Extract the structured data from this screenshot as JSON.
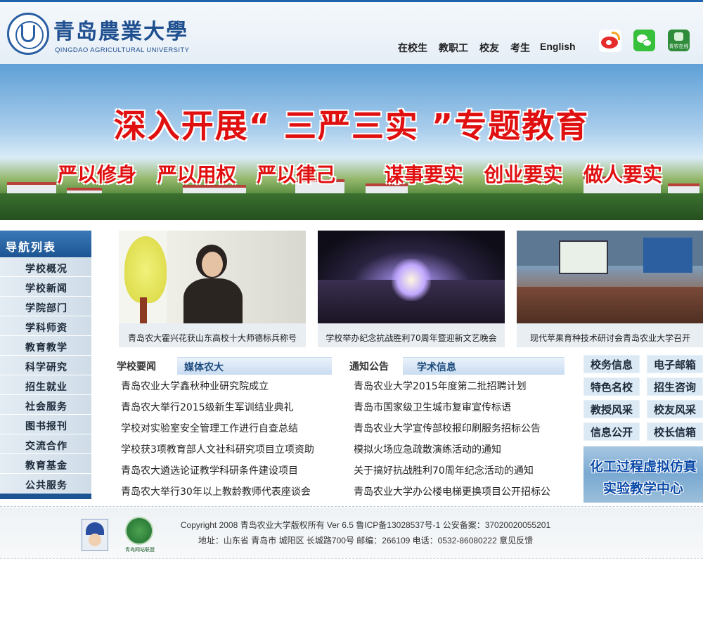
{
  "header": {
    "logo_cn": "青岛農業大學",
    "logo_en": "QINGDAO AGRICULTURAL UNIVERSITY",
    "nav": [
      "在校生",
      "教职工",
      "校友",
      "考生",
      "English"
    ],
    "social_icons": [
      "weibo-icon",
      "wechat-icon",
      "app-icon"
    ],
    "app_icon_label": "青农在线"
  },
  "banner": {
    "title": "深入开展“ 三严三实 ”专题教育",
    "slogans": [
      "严以修身",
      "严以用权",
      "严以律己",
      "谋事要实",
      "创业要实",
      "做人要实"
    ]
  },
  "sidebar": {
    "heading": "导航列表",
    "items": [
      "学校概况",
      "学校新闻",
      "学院部门",
      "学科师资",
      "教育教学",
      "科学研究",
      "招生就业",
      "社会服务",
      "图书报刊",
      "交流合作",
      "教育基金",
      "公共服务"
    ]
  },
  "photos": [
    {
      "caption": "青岛农大霍兴花获山东高校十大师德标兵称号"
    },
    {
      "caption": "学校举办纪念抗战胜利70周年暨迎新文艺晚会"
    },
    {
      "caption": "现代苹果育种技术研讨会青岛农业大学召开"
    }
  ],
  "news": {
    "tabs": [
      "学校要闻",
      "媒体农大"
    ],
    "items": [
      "青岛农业大学鑫秋种业研究院成立",
      "青岛农大举行2015级新生军训结业典礼",
      "学校对实验室安全管理工作进行自查总结",
      "学校获3项教育部人文社科研究项目立项资助",
      "青岛农大遴选论证教学科研条件建设项目",
      "青岛农大举行30年以上教龄教师代表座谈会"
    ]
  },
  "notices": {
    "tabs": [
      "通知公告",
      "学术信息"
    ],
    "items": [
      "青岛农业大学2015年度第二批招聘计划",
      "青岛市国家级卫生城市复审宣传标语",
      "青岛农业大学宣传部校报印刷服务招标公告",
      "模拟火场应急疏散演练活动的通知",
      "关于搞好抗战胜利70周年纪念活动的通知",
      "青岛农业大学办公楼电梯更换项目公开招标公"
    ]
  },
  "quick_links": [
    "校务信息",
    "电子邮箱",
    "特色名校",
    "招生咨询",
    "教授风采",
    "校友风采",
    "信息公开",
    "校长信箱"
  ],
  "promo": {
    "line1": "化工过程虚拟仿真",
    "line2": "实验教学中心"
  },
  "footer": {
    "copyright": "Copyright 2008 青岛农业大学版权所有 Ver 6.5 鲁ICP备13028537号-1 公安备案：37020020055201",
    "address": "地址：山东省 青岛市 城阳区 长城路700号 邮编：266109 电话：0532-86080222 意见反馈",
    "badge_label": "青岛网站联盟"
  }
}
